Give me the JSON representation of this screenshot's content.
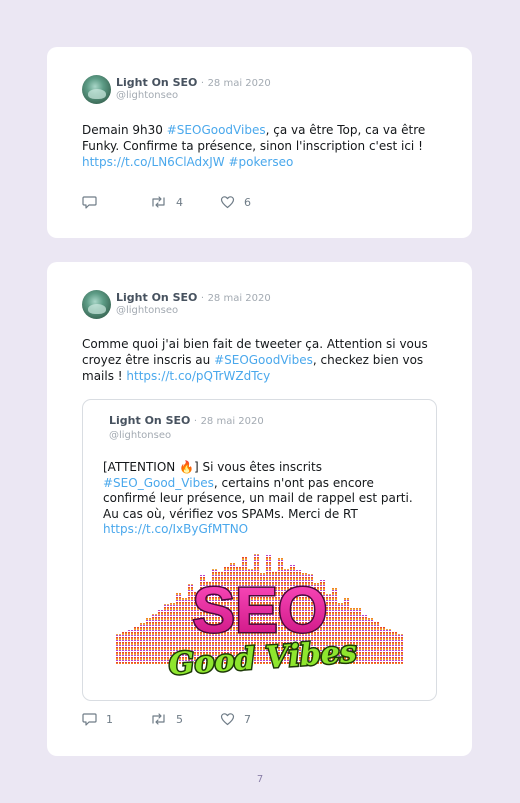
{
  "tweets": [
    {
      "author": "Light On SEO",
      "separator": "·",
      "date": "28 mai 2020",
      "handle": "@lightonseo",
      "text": {
        "part1": "Demain 9h30 ",
        "hashtag1": "#SEOGoodVibes",
        "part2": ", ça va être Top, ca va être Funky. Confirme ta présence, sinon l'inscription c'est ici ! ",
        "link": "https://t.co/LN6ClAdxJW",
        "part3": " ",
        "hashtag2": "#pokerseo"
      },
      "actions": {
        "replies": "",
        "retweets": "4",
        "likes": "6"
      }
    },
    {
      "author": "Light On SEO",
      "separator": "·",
      "date": "28 mai 2020",
      "handle": "@lightonseo",
      "text": {
        "part1": "Comme quoi j'ai bien fait de tweeter ça. Attention si vous croyez être inscris au ",
        "hashtag1": "#SEOGoodVibes",
        "part2": ", checkez bien vos mails ! ",
        "link": "https://t.co/pQTrWZdTcy"
      },
      "quoted": {
        "author": "Light On SEO",
        "separator": "·",
        "date": "28 mai 2020",
        "handle": "@lightonseo",
        "text": {
          "part1": "[ATTENTION ",
          "emoji": "🔥",
          "part2": "] Si vous êtes inscrits ",
          "hashtag": "#SEO_Good_Vibes",
          "part3": ", certains n'ont pas encore confirmé leur présence, un mail de rappel est parti. Au cas où, vérifiez vos SPAMs. Merci de RT ",
          "link": "https://t.co/IxByGfMTNO"
        },
        "image": {
          "logo_word": "SEO",
          "logo_tagline": "Good Vibes"
        }
      },
      "actions": {
        "replies": "1",
        "retweets": "5",
        "likes": "7"
      }
    }
  ],
  "page_number": "7",
  "colors": {
    "background": "#ebe7f3",
    "card": "#ffffff",
    "link": "#4aa8ec",
    "muted": "#a3aab2",
    "logo_magenta": "#e0249a",
    "logo_green": "#8ee62e"
  },
  "icons": [
    "reply-icon",
    "retweet-icon",
    "like-icon",
    "flame-emoji"
  ]
}
